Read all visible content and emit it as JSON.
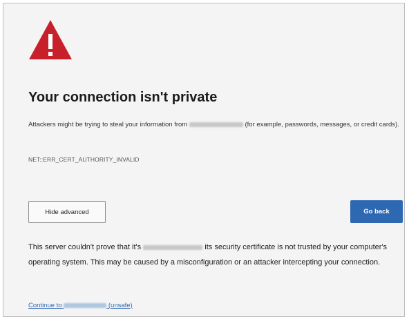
{
  "colors": {
    "warning_red": "#c8202a",
    "button_blue": "#2e68b3",
    "link_blue": "#2e68b3",
    "background": "#f4f4f4"
  },
  "icon": "warning-triangle-icon",
  "title": "Your connection isn't private",
  "description": {
    "before": "Attackers might be trying to steal your information from",
    "after": "(for example, passwords, messages, or credit cards)."
  },
  "error_code": "NET::ERR_CERT_AUTHORITY_INVALID",
  "buttons": {
    "hide_advanced": "Hide advanced",
    "go_back": "Go back"
  },
  "advanced": {
    "before": "This server couldn't prove that it's",
    "after": "its security certificate is not trusted by your computer's operating system. This may be caused by a misconfiguration or an attacker intercepting your connection."
  },
  "continue": {
    "before": "Continue to",
    "after": "(unsafe)"
  }
}
